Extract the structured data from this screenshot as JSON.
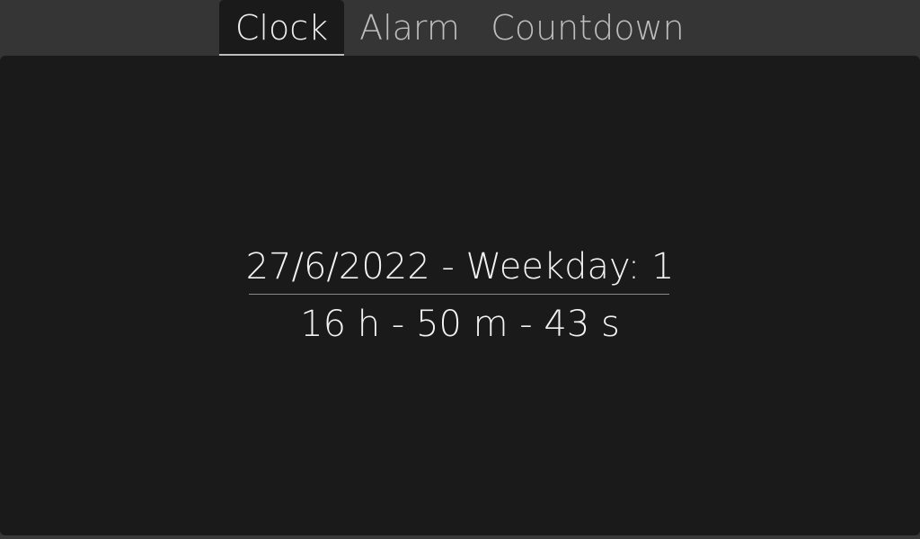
{
  "tabs": [
    {
      "label": "Clock",
      "active": true
    },
    {
      "label": "Alarm",
      "active": false
    },
    {
      "label": "Countdown",
      "active": false
    }
  ],
  "clock": {
    "date_text": "27/6/2022 - Weekday: 1",
    "time_text": "16 h - 50 m - 43 s"
  },
  "colors": {
    "background": "#353535",
    "panel": "#1a1a1a",
    "text": "#f2f2f2",
    "inactive_tab": "#bdbdbd"
  }
}
